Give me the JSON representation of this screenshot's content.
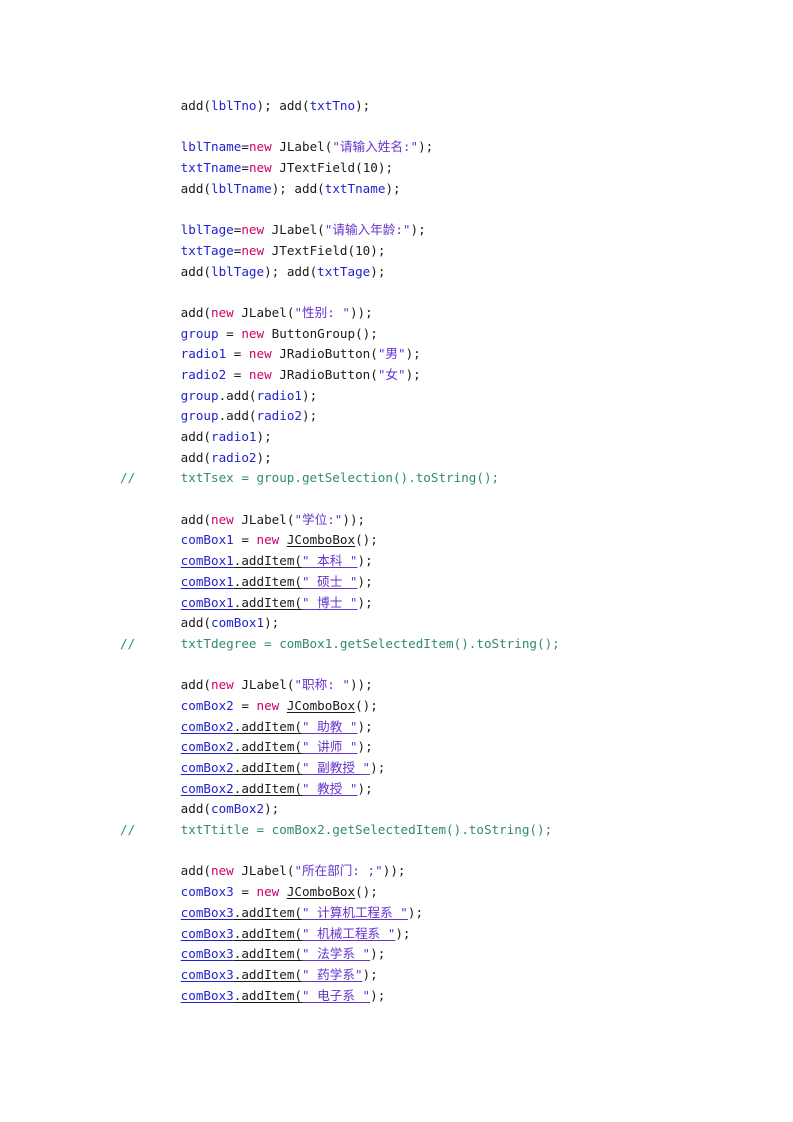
{
  "document": {
    "kind": "java-source-listing",
    "language": "Java",
    "background_color": "#ffffff",
    "colors": {
      "plain": "#1a1a1a",
      "variable": "#2222cc",
      "keyword": "#cc0066",
      "string": "#6633cc",
      "comment": "#2e8b72",
      "underline": "#2222cc"
    }
  },
  "code": {
    "lines": [
      {
        "id": "line-1",
        "indent": 4,
        "tokens": [
          {
            "t": "add(",
            "c": "plain"
          },
          {
            "t": "lblTno",
            "c": "var"
          },
          {
            "t": "); add(",
            "c": "plain"
          },
          {
            "t": "txtTno",
            "c": "var"
          },
          {
            "t": ");",
            "c": "plain"
          }
        ]
      },
      {
        "id": "line-2",
        "blank": true,
        "tokens": []
      },
      {
        "id": "line-3",
        "indent": 4,
        "tokens": [
          {
            "t": "lblTname",
            "c": "var"
          },
          {
            "t": "=",
            "c": "plain"
          },
          {
            "t": "new",
            "c": "kw"
          },
          {
            "t": " JLabel(",
            "c": "plain"
          },
          {
            "t": "\"请输入姓名:\"",
            "c": "str"
          },
          {
            "t": ");",
            "c": "plain"
          }
        ]
      },
      {
        "id": "line-4",
        "indent": 4,
        "tokens": [
          {
            "t": "txtTname",
            "c": "var"
          },
          {
            "t": "=",
            "c": "plain"
          },
          {
            "t": "new",
            "c": "kw"
          },
          {
            "t": " JTextField(",
            "c": "plain"
          },
          {
            "t": "10",
            "c": "num"
          },
          {
            "t": ");",
            "c": "plain"
          }
        ]
      },
      {
        "id": "line-5",
        "indent": 4,
        "tokens": [
          {
            "t": "add(",
            "c": "plain"
          },
          {
            "t": "lblTname",
            "c": "var"
          },
          {
            "t": "); add(",
            "c": "plain"
          },
          {
            "t": "txtTname",
            "c": "var"
          },
          {
            "t": ");",
            "c": "plain"
          }
        ]
      },
      {
        "id": "line-6",
        "blank": true,
        "tokens": []
      },
      {
        "id": "line-7",
        "indent": 4,
        "tokens": [
          {
            "t": "lblTage",
            "c": "var"
          },
          {
            "t": "=",
            "c": "plain"
          },
          {
            "t": "new",
            "c": "kw"
          },
          {
            "t": " JLabel(",
            "c": "plain"
          },
          {
            "t": "\"请输入年龄:\"",
            "c": "str"
          },
          {
            "t": ");",
            "c": "plain"
          }
        ]
      },
      {
        "id": "line-8",
        "indent": 4,
        "tokens": [
          {
            "t": "txtTage",
            "c": "var"
          },
          {
            "t": "=",
            "c": "plain"
          },
          {
            "t": "new",
            "c": "kw"
          },
          {
            "t": " JTextField(",
            "c": "plain"
          },
          {
            "t": "10",
            "c": "num"
          },
          {
            "t": ");",
            "c": "plain"
          }
        ]
      },
      {
        "id": "line-9",
        "indent": 4,
        "tokens": [
          {
            "t": "add(",
            "c": "plain"
          },
          {
            "t": "lblTage",
            "c": "var"
          },
          {
            "t": "); add(",
            "c": "plain"
          },
          {
            "t": "txtTage",
            "c": "var"
          },
          {
            "t": ");",
            "c": "plain"
          }
        ]
      },
      {
        "id": "line-10",
        "blank": true,
        "tokens": []
      },
      {
        "id": "line-11",
        "indent": 4,
        "tokens": [
          {
            "t": "add(",
            "c": "plain"
          },
          {
            "t": "new",
            "c": "kw"
          },
          {
            "t": " JLabel(",
            "c": "plain"
          },
          {
            "t": "\"性别: \"",
            "c": "str"
          },
          {
            "t": "));",
            "c": "plain"
          }
        ]
      },
      {
        "id": "line-12",
        "indent": 4,
        "tokens": [
          {
            "t": "group",
            "c": "var"
          },
          {
            "t": " = ",
            "c": "plain"
          },
          {
            "t": "new",
            "c": "kw"
          },
          {
            "t": " ButtonGroup();",
            "c": "plain"
          }
        ]
      },
      {
        "id": "line-13",
        "indent": 4,
        "tokens": [
          {
            "t": "radio1",
            "c": "var"
          },
          {
            "t": " = ",
            "c": "plain"
          },
          {
            "t": "new",
            "c": "kw"
          },
          {
            "t": " JRadioButton(",
            "c": "plain"
          },
          {
            "t": "\"男\"",
            "c": "str"
          },
          {
            "t": ");",
            "c": "plain"
          }
        ]
      },
      {
        "id": "line-14",
        "indent": 4,
        "tokens": [
          {
            "t": "radio2",
            "c": "var"
          },
          {
            "t": " = ",
            "c": "plain"
          },
          {
            "t": "new",
            "c": "kw"
          },
          {
            "t": " JRadioButton(",
            "c": "plain"
          },
          {
            "t": "\"女\"",
            "c": "str"
          },
          {
            "t": ");",
            "c": "plain"
          }
        ]
      },
      {
        "id": "line-15",
        "indent": 4,
        "tokens": [
          {
            "t": "group",
            "c": "var"
          },
          {
            "t": ".add(",
            "c": "plain"
          },
          {
            "t": "radio1",
            "c": "var"
          },
          {
            "t": ");",
            "c": "plain"
          }
        ]
      },
      {
        "id": "line-16",
        "indent": 4,
        "tokens": [
          {
            "t": "group",
            "c": "var"
          },
          {
            "t": ".add(",
            "c": "plain"
          },
          {
            "t": "radio2",
            "c": "var"
          },
          {
            "t": ");",
            "c": "plain"
          }
        ]
      },
      {
        "id": "line-17",
        "indent": 4,
        "tokens": [
          {
            "t": "add(",
            "c": "plain"
          },
          {
            "t": "radio1",
            "c": "var"
          },
          {
            "t": ");",
            "c": "plain"
          }
        ]
      },
      {
        "id": "line-18",
        "indent": 4,
        "tokens": [
          {
            "t": "add(",
            "c": "plain"
          },
          {
            "t": "radio2",
            "c": "var"
          },
          {
            "t": ");",
            "c": "plain"
          }
        ]
      },
      {
        "id": "line-19",
        "indent": 0,
        "tokens": [
          {
            "t": "//      txtTsex = group.getSelection().toString();",
            "c": "comment"
          }
        ]
      },
      {
        "id": "line-20",
        "blank": true,
        "tokens": []
      },
      {
        "id": "line-21",
        "indent": 4,
        "tokens": [
          {
            "t": "add(",
            "c": "plain"
          },
          {
            "t": "new",
            "c": "kw"
          },
          {
            "t": " JLabel(",
            "c": "plain"
          },
          {
            "t": "\"学位:\"",
            "c": "str"
          },
          {
            "t": "));",
            "c": "plain"
          }
        ]
      },
      {
        "id": "line-22",
        "indent": 4,
        "tokens": [
          {
            "t": "comBox1",
            "c": "var"
          },
          {
            "t": " = ",
            "c": "plain"
          },
          {
            "t": "new",
            "c": "kw"
          },
          {
            "t": " ",
            "c": "plain"
          },
          {
            "t": "JComboBox",
            "c": "plain",
            "ul": true
          },
          {
            "t": "();",
            "c": "plain"
          }
        ]
      },
      {
        "id": "line-23",
        "indent": 4,
        "tokens": [
          {
            "t": "comBox1",
            "c": "var",
            "ul": true
          },
          {
            "t": ".addItem(",
            "c": "plain",
            "ul": true
          },
          {
            "t": "\" 本科 \"",
            "c": "str",
            "ul": true
          },
          {
            "t": ");",
            "c": "plain"
          }
        ]
      },
      {
        "id": "line-24",
        "indent": 4,
        "tokens": [
          {
            "t": "comBox1",
            "c": "var",
            "ul": true
          },
          {
            "t": ".addItem(",
            "c": "plain",
            "ul": true
          },
          {
            "t": "\" 硕士 \"",
            "c": "str",
            "ul": true
          },
          {
            "t": ");",
            "c": "plain"
          }
        ]
      },
      {
        "id": "line-25",
        "indent": 4,
        "tokens": [
          {
            "t": "comBox1",
            "c": "var",
            "ul": true
          },
          {
            "t": ".addItem(",
            "c": "plain",
            "ul": true
          },
          {
            "t": "\" 博士 \"",
            "c": "str",
            "ul": true
          },
          {
            "t": ");",
            "c": "plain"
          }
        ]
      },
      {
        "id": "line-26",
        "indent": 4,
        "tokens": [
          {
            "t": "add(",
            "c": "plain"
          },
          {
            "t": "comBox1",
            "c": "var"
          },
          {
            "t": ");",
            "c": "plain"
          }
        ]
      },
      {
        "id": "line-27",
        "indent": 0,
        "tokens": [
          {
            "t": "//      txtTdegree = comBox1.getSelectedItem().toString();",
            "c": "comment"
          }
        ]
      },
      {
        "id": "line-28",
        "blank": true,
        "tokens": []
      },
      {
        "id": "line-29",
        "indent": 4,
        "tokens": [
          {
            "t": "add(",
            "c": "plain"
          },
          {
            "t": "new",
            "c": "kw"
          },
          {
            "t": " JLabel(",
            "c": "plain"
          },
          {
            "t": "\"职称: \"",
            "c": "str"
          },
          {
            "t": "));",
            "c": "plain"
          }
        ]
      },
      {
        "id": "line-30",
        "indent": 4,
        "tokens": [
          {
            "t": "comBox2",
            "c": "var"
          },
          {
            "t": " = ",
            "c": "plain"
          },
          {
            "t": "new",
            "c": "kw"
          },
          {
            "t": " ",
            "c": "plain"
          },
          {
            "t": "JComboBox",
            "c": "plain",
            "ul": true
          },
          {
            "t": "();",
            "c": "plain"
          }
        ]
      },
      {
        "id": "line-31",
        "indent": 4,
        "tokens": [
          {
            "t": "comBox2",
            "c": "var",
            "ul": true
          },
          {
            "t": ".addItem(",
            "c": "plain",
            "ul": true
          },
          {
            "t": "\" 助教 \"",
            "c": "str",
            "ul": true
          },
          {
            "t": ");",
            "c": "plain"
          }
        ]
      },
      {
        "id": "line-32",
        "indent": 4,
        "tokens": [
          {
            "t": "comBox2",
            "c": "var",
            "ul": true
          },
          {
            "t": ".addItem(",
            "c": "plain",
            "ul": true
          },
          {
            "t": "\" 讲师 \"",
            "c": "str",
            "ul": true
          },
          {
            "t": ");",
            "c": "plain"
          }
        ]
      },
      {
        "id": "line-33",
        "indent": 4,
        "tokens": [
          {
            "t": "comBox2",
            "c": "var",
            "ul": true
          },
          {
            "t": ".addItem(",
            "c": "plain",
            "ul": true
          },
          {
            "t": "\" 副教授 \"",
            "c": "str",
            "ul": true
          },
          {
            "t": ");",
            "c": "plain"
          }
        ]
      },
      {
        "id": "line-34",
        "indent": 4,
        "tokens": [
          {
            "t": "comBox2",
            "c": "var",
            "ul": true
          },
          {
            "t": ".addItem(",
            "c": "plain",
            "ul": true
          },
          {
            "t": "\" 教授 \"",
            "c": "str",
            "ul": true
          },
          {
            "t": ");",
            "c": "plain"
          }
        ]
      },
      {
        "id": "line-35",
        "indent": 4,
        "tokens": [
          {
            "t": "add(",
            "c": "plain"
          },
          {
            "t": "comBox2",
            "c": "var"
          },
          {
            "t": ");",
            "c": "plain"
          }
        ]
      },
      {
        "id": "line-36",
        "indent": 0,
        "tokens": [
          {
            "t": "//      txtTtitle = comBox2.getSelectedItem().toString();",
            "c": "comment"
          }
        ]
      },
      {
        "id": "line-37",
        "blank": true,
        "tokens": []
      },
      {
        "id": "line-38",
        "indent": 4,
        "tokens": [
          {
            "t": "add(",
            "c": "plain"
          },
          {
            "t": "new",
            "c": "kw"
          },
          {
            "t": " JLabel(",
            "c": "plain"
          },
          {
            "t": "\"所在部门: ;\"",
            "c": "str"
          },
          {
            "t": "));",
            "c": "plain"
          }
        ]
      },
      {
        "id": "line-39",
        "indent": 4,
        "tokens": [
          {
            "t": "comBox3",
            "c": "var"
          },
          {
            "t": " = ",
            "c": "plain"
          },
          {
            "t": "new",
            "c": "kw"
          },
          {
            "t": " ",
            "c": "plain"
          },
          {
            "t": "JComboBox",
            "c": "plain",
            "ul": true
          },
          {
            "t": "();",
            "c": "plain"
          }
        ]
      },
      {
        "id": "line-40",
        "indent": 4,
        "tokens": [
          {
            "t": "comBox3",
            "c": "var",
            "ul": true
          },
          {
            "t": ".addItem(",
            "c": "plain",
            "ul": true
          },
          {
            "t": "\" 计算机工程系 \"",
            "c": "str",
            "ul": true
          },
          {
            "t": ");",
            "c": "plain"
          }
        ]
      },
      {
        "id": "line-41",
        "indent": 4,
        "tokens": [
          {
            "t": "comBox3",
            "c": "var",
            "ul": true
          },
          {
            "t": ".addItem(",
            "c": "plain",
            "ul": true
          },
          {
            "t": "\" 机械工程系 \"",
            "c": "str",
            "ul": true
          },
          {
            "t": ");",
            "c": "plain"
          }
        ]
      },
      {
        "id": "line-42",
        "indent": 4,
        "tokens": [
          {
            "t": "comBox3",
            "c": "var",
            "ul": true
          },
          {
            "t": ".addItem(",
            "c": "plain",
            "ul": true
          },
          {
            "t": "\" 法学系 \"",
            "c": "str",
            "ul": true
          },
          {
            "t": ");",
            "c": "plain"
          }
        ]
      },
      {
        "id": "line-43",
        "indent": 4,
        "tokens": [
          {
            "t": "comBox3",
            "c": "var",
            "ul": true
          },
          {
            "t": ".addItem(",
            "c": "plain",
            "ul": true
          },
          {
            "t": "\" 药学系\"",
            "c": "str",
            "ul": true
          },
          {
            "t": ");",
            "c": "plain"
          }
        ]
      },
      {
        "id": "line-44",
        "indent": 4,
        "tokens": [
          {
            "t": "comBox3",
            "c": "var",
            "ul": true
          },
          {
            "t": ".addItem(",
            "c": "plain",
            "ul": true
          },
          {
            "t": "\" 电子系 \"",
            "c": "str",
            "ul": true
          },
          {
            "t": ");",
            "c": "plain"
          }
        ]
      }
    ]
  }
}
